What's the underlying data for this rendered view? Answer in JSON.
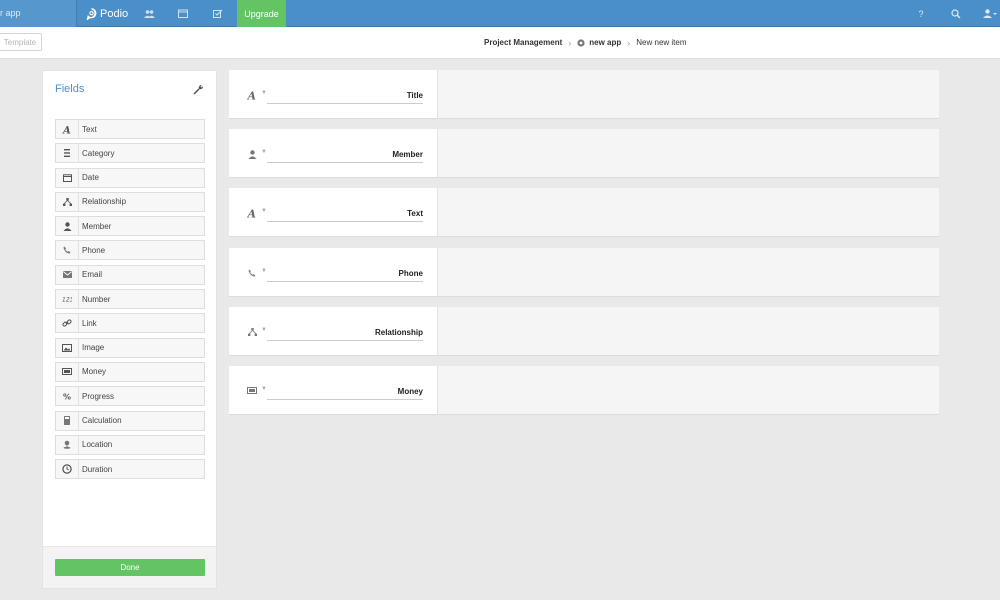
{
  "topbar": {
    "search_text": "r app",
    "logo_text": "Podio",
    "upgrade_label": "Upgrade",
    "help_label": "?"
  },
  "subbar": {
    "template_label": "Template",
    "breadcrumb": {
      "workspace": "Project Management",
      "app": "new app",
      "item": "New new item"
    }
  },
  "fields_panel": {
    "title": "Fields",
    "items": [
      {
        "label": "Text",
        "icon": "text-icon"
      },
      {
        "label": "Category",
        "icon": "category-icon"
      },
      {
        "label": "Date",
        "icon": "calendar-icon"
      },
      {
        "label": "Relationship",
        "icon": "relationship-icon"
      },
      {
        "label": "Member",
        "icon": "member-icon"
      },
      {
        "label": "Phone",
        "icon": "phone-icon"
      },
      {
        "label": "Email",
        "icon": "email-icon"
      },
      {
        "label": "Number",
        "icon": "number-icon"
      },
      {
        "label": "Link",
        "icon": "link-icon"
      },
      {
        "label": "Image",
        "icon": "image-icon"
      },
      {
        "label": "Money",
        "icon": "money-icon"
      },
      {
        "label": "Progress",
        "icon": "progress-icon"
      },
      {
        "label": "Calculation",
        "icon": "calculation-icon"
      },
      {
        "label": "Location",
        "icon": "location-icon"
      },
      {
        "label": "Duration",
        "icon": "duration-icon"
      }
    ],
    "done_label": "Done"
  },
  "form": {
    "rows": [
      {
        "label": "Title",
        "icon": "text-icon"
      },
      {
        "label": "Member",
        "icon": "member-icon"
      },
      {
        "label": "Text",
        "icon": "text-icon"
      },
      {
        "label": "Phone",
        "icon": "phone-icon"
      },
      {
        "label": "Relationship",
        "icon": "relationship-icon"
      },
      {
        "label": "Money",
        "icon": "money-icon"
      }
    ]
  },
  "colors": {
    "topbar": "#4a8fc8",
    "accent_green": "#62c463",
    "background": "#e9e9e9"
  }
}
